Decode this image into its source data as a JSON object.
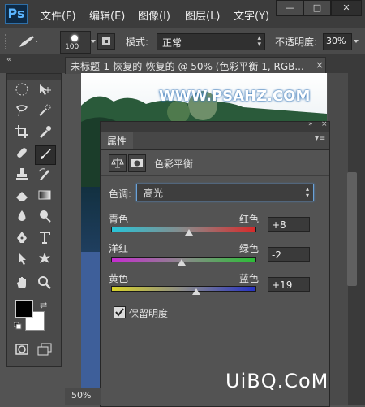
{
  "app": {
    "logo": "Ps"
  },
  "menu": [
    "文件(F)",
    "编辑(E)",
    "图像(I)",
    "图层(L)",
    "文字(Y)"
  ],
  "window_controls": {
    "minimize": "—",
    "restore": "□",
    "close": "✕"
  },
  "options_bar": {
    "brush_size": "100",
    "mode_label": "模式:",
    "mode_value": "正常",
    "opacity_label": "不透明度:",
    "opacity_value": "30%"
  },
  "document": {
    "tab_title": "未标题-1-恢复的-恢复的 @ 50% (色彩平衡 1, RGB...",
    "tab_close": "×",
    "zoom_status": "50%",
    "canvas_watermark": "WWW.PSAHZ.COM"
  },
  "panel": {
    "title": "属性",
    "adjustment_name": "色彩平衡",
    "tone_label": "色调:",
    "tone_value": "高光",
    "sliders": [
      {
        "left": "青色",
        "right": "红色",
        "value_text": "+8",
        "value": 8
      },
      {
        "left": "洋红",
        "right": "绿色",
        "value_text": "-2",
        "value": -2
      },
      {
        "left": "黄色",
        "right": "蓝色",
        "value_text": "+19",
        "value": 19
      }
    ],
    "preserve_luminosity_label": "保留明度",
    "preserve_luminosity_checked": true
  },
  "watermark_bottom": "UiBQ.CoM",
  "colors": {
    "foreground": "#000000",
    "background": "#ffffff",
    "cyan": "#27c4d8",
    "red": "#d82a2a",
    "magenta": "#c62bd0",
    "green": "#2bbf36",
    "yellow": "#d7d22a",
    "blue": "#2632c4"
  },
  "icons": [
    "marquee-icon",
    "move-icon",
    "lasso-icon",
    "quick-select-icon",
    "crop-icon",
    "eyedropper-icon",
    "healing-icon",
    "brush-icon",
    "stamp-icon",
    "history-brush-icon",
    "eraser-icon",
    "gradient-icon",
    "blur-icon",
    "dodge-icon",
    "pen-icon",
    "type-icon",
    "path-select-icon",
    "shape-icon",
    "hand-icon",
    "zoom-icon",
    "quick-mask-icon",
    "screen-mode-icon"
  ]
}
